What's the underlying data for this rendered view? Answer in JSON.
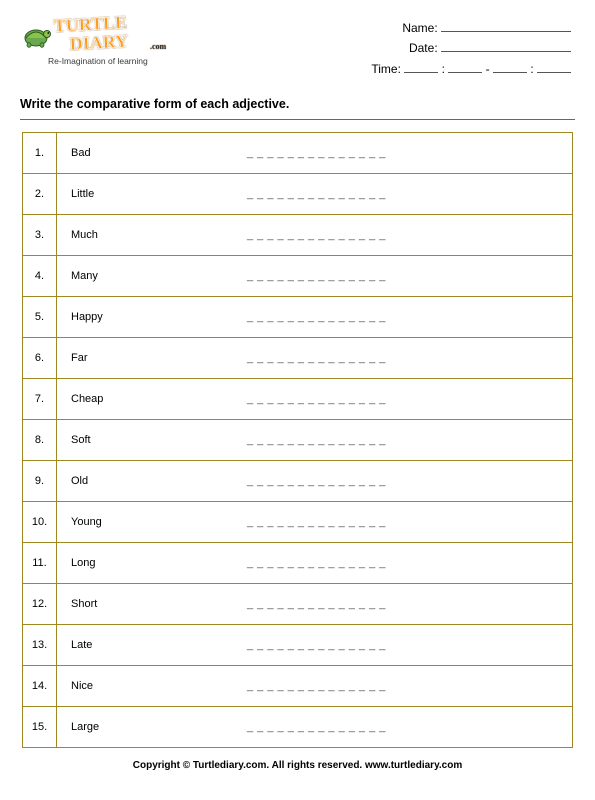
{
  "brand": {
    "name_top": "TURTLE",
    "name_bottom": "DIARY",
    "domain": ".com",
    "tagline": "Re-Imagination of learning"
  },
  "meta": {
    "name_label": "Name:",
    "date_label": "Date:",
    "time_label": "Time:",
    "colon": ":",
    "dash": "-"
  },
  "instruction": "Write the comparative form of each adjective.",
  "blank": "_ _  _ _  _ _  _ _  _ _  _ _  _ _",
  "items": [
    {
      "n": "1.",
      "word": "Bad"
    },
    {
      "n": "2.",
      "word": "Little"
    },
    {
      "n": "3.",
      "word": "Much"
    },
    {
      "n": "4.",
      "word": "Many"
    },
    {
      "n": "5.",
      "word": "Happy"
    },
    {
      "n": "6.",
      "word": "Far"
    },
    {
      "n": "7.",
      "word": "Cheap"
    },
    {
      "n": "8.",
      "word": "Soft"
    },
    {
      "n": "9.",
      "word": "Old"
    },
    {
      "n": "10.",
      "word": "Young"
    },
    {
      "n": "11.",
      "word": "Long"
    },
    {
      "n": "12.",
      "word": "Short"
    },
    {
      "n": "13.",
      "word": "Late"
    },
    {
      "n": "14.",
      "word": "Nice"
    },
    {
      "n": "15.",
      "word": "Large"
    }
  ],
  "footer": "Copyright © Turtlediary.com. All rights reserved. www.turtlediary.com"
}
